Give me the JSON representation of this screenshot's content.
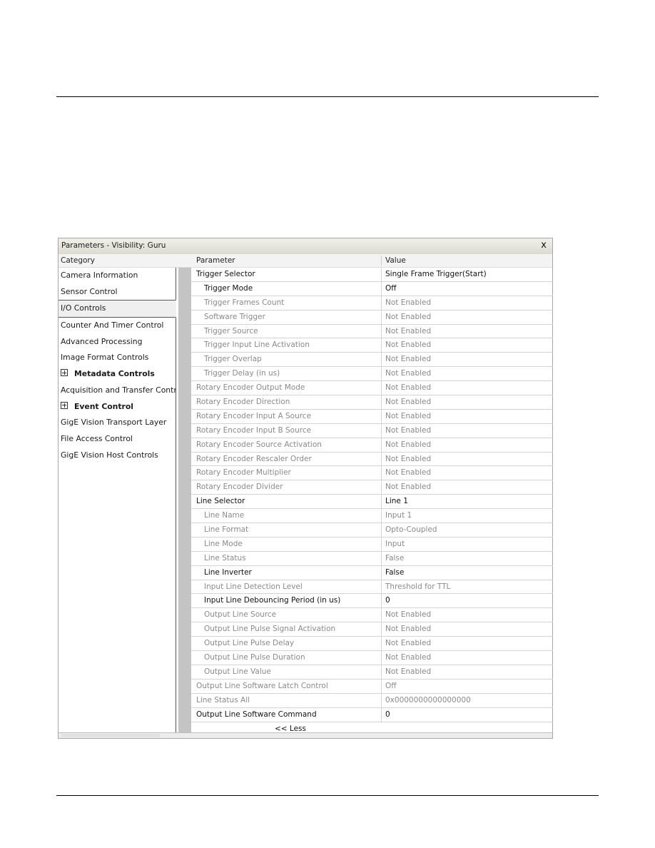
{
  "window": {
    "title": "Parameters - Visibility: Guru",
    "close_label": "x"
  },
  "headers": {
    "category": "Category",
    "parameter": "Parameter",
    "value": "Value"
  },
  "categories": [
    {
      "label": "Camera Information",
      "bold": false,
      "expandable": false,
      "selected": false
    },
    {
      "label": "Sensor Control",
      "bold": false,
      "expandable": false,
      "selected": false
    },
    {
      "label": "I/O Controls",
      "bold": false,
      "expandable": false,
      "selected": true
    },
    {
      "label": "Counter And Timer Control",
      "bold": false,
      "expandable": false,
      "selected": false
    },
    {
      "label": "Advanced Processing",
      "bold": false,
      "expandable": false,
      "selected": false
    },
    {
      "label": "Image Format Controls",
      "bold": false,
      "expandable": false,
      "selected": false
    },
    {
      "label": "Metadata Controls",
      "bold": true,
      "expandable": true,
      "selected": false
    },
    {
      "label": "Acquisition and Transfer Contr...",
      "bold": false,
      "expandable": false,
      "selected": false
    },
    {
      "label": "Event Control",
      "bold": true,
      "expandable": true,
      "selected": false
    },
    {
      "label": "GigE Vision Transport Layer",
      "bold": false,
      "expandable": false,
      "selected": false
    },
    {
      "label": "File Access Control",
      "bold": false,
      "expandable": false,
      "selected": false
    },
    {
      "label": "GigE Vision Host Controls",
      "bold": false,
      "expandable": false,
      "selected": false
    }
  ],
  "parameters": [
    {
      "name": "Trigger Selector",
      "value": "Single Frame Trigger(Start)",
      "enabled": true,
      "indent": false
    },
    {
      "name": "Trigger Mode",
      "value": "Off",
      "enabled": true,
      "indent": true
    },
    {
      "name": "Trigger Frames Count",
      "value": "Not Enabled",
      "enabled": false,
      "indent": true
    },
    {
      "name": "Software Trigger",
      "value": "Not Enabled",
      "enabled": false,
      "indent": true
    },
    {
      "name": "Trigger Source",
      "value": "Not Enabled",
      "enabled": false,
      "indent": true
    },
    {
      "name": "Trigger Input Line Activation",
      "value": "Not Enabled",
      "enabled": false,
      "indent": true
    },
    {
      "name": "Trigger Overlap",
      "value": "Not Enabled",
      "enabled": false,
      "indent": true
    },
    {
      "name": "Trigger Delay (in us)",
      "value": "Not Enabled",
      "enabled": false,
      "indent": true
    },
    {
      "name": "Rotary Encoder Output Mode",
      "value": "Not Enabled",
      "enabled": false,
      "indent": false
    },
    {
      "name": "Rotary Encoder Direction",
      "value": "Not Enabled",
      "enabled": false,
      "indent": false
    },
    {
      "name": "Rotary Encoder Input A Source",
      "value": "Not Enabled",
      "enabled": false,
      "indent": false
    },
    {
      "name": "Rotary Encoder Input B Source",
      "value": "Not Enabled",
      "enabled": false,
      "indent": false
    },
    {
      "name": "Rotary Encoder Source Activation",
      "value": "Not Enabled",
      "enabled": false,
      "indent": false
    },
    {
      "name": "Rotary Encoder Rescaler Order",
      "value": "Not Enabled",
      "enabled": false,
      "indent": false
    },
    {
      "name": "Rotary Encoder Multiplier",
      "value": "Not Enabled",
      "enabled": false,
      "indent": false
    },
    {
      "name": "Rotary Encoder Divider",
      "value": "Not Enabled",
      "enabled": false,
      "indent": false
    },
    {
      "name": "Line Selector",
      "value": "Line 1",
      "enabled": true,
      "indent": false
    },
    {
      "name": "Line Name",
      "value": "Input 1",
      "enabled": false,
      "indent": true
    },
    {
      "name": "Line Format",
      "value": "Opto-Coupled",
      "enabled": false,
      "indent": true
    },
    {
      "name": "Line Mode",
      "value": "Input",
      "enabled": false,
      "indent": true
    },
    {
      "name": "Line Status",
      "value": "False",
      "enabled": false,
      "indent": true
    },
    {
      "name": "Line Inverter",
      "value": "False",
      "enabled": true,
      "indent": true
    },
    {
      "name": "Input Line Detection Level",
      "value": "Threshold for TTL",
      "enabled": false,
      "indent": true
    },
    {
      "name": "Input Line Debouncing Period (in us)",
      "value": "0",
      "enabled": true,
      "indent": true
    },
    {
      "name": "Output Line Source",
      "value": "Not Enabled",
      "enabled": false,
      "indent": true
    },
    {
      "name": "Output Line Pulse Signal Activation",
      "value": "Not Enabled",
      "enabled": false,
      "indent": true
    },
    {
      "name": "Output Line Pulse Delay",
      "value": "Not Enabled",
      "enabled": false,
      "indent": true
    },
    {
      "name": "Output Line Pulse Duration",
      "value": "Not Enabled",
      "enabled": false,
      "indent": true
    },
    {
      "name": "Output Line Value",
      "value": "Not Enabled",
      "enabled": false,
      "indent": true
    },
    {
      "name": "Output Line Software Latch Control",
      "value": "Off",
      "enabled": false,
      "indent": false
    },
    {
      "name": "Line Status All",
      "value": "0x0000000000000000",
      "enabled": false,
      "indent": false
    },
    {
      "name": "Output Line Software Command",
      "value": "0",
      "enabled": true,
      "indent": false
    }
  ],
  "less_button_label": "<< Less"
}
